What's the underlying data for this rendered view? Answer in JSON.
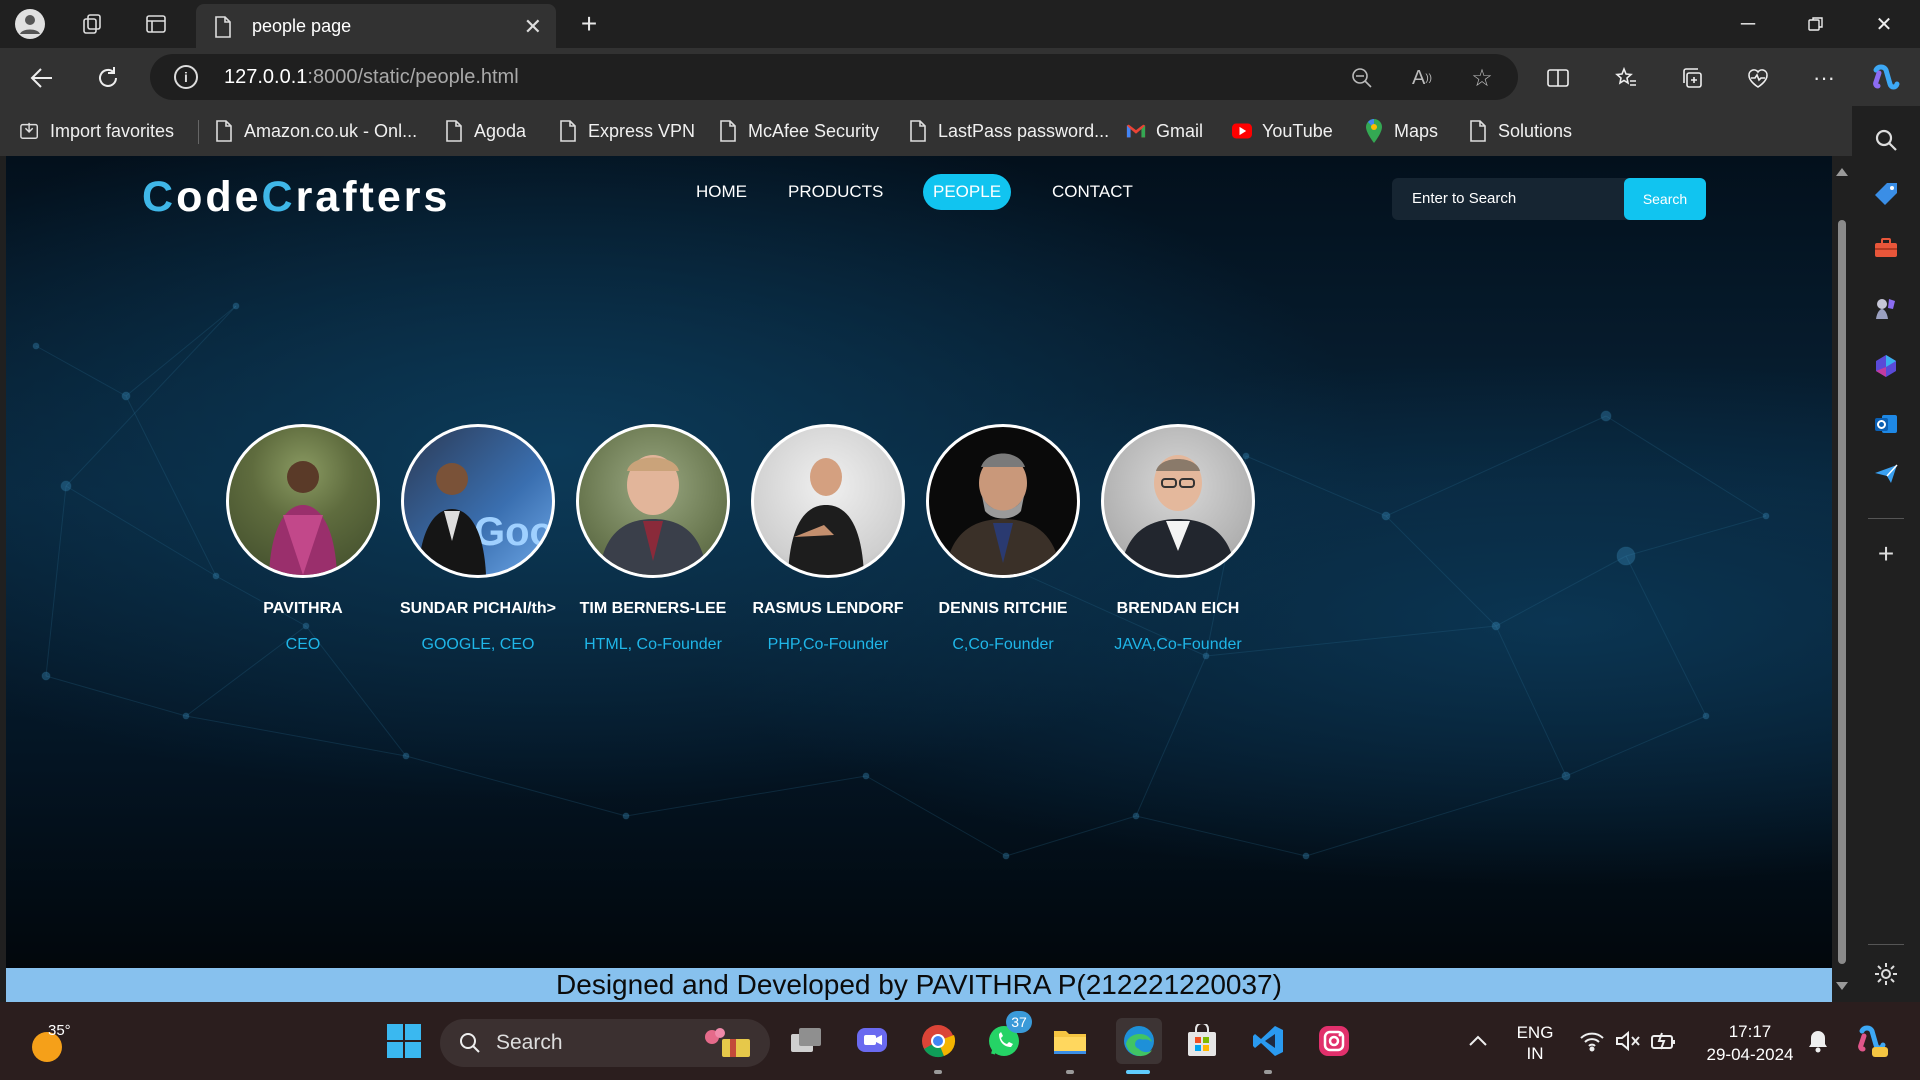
{
  "browser": {
    "tab_title": "people page",
    "url_host": "127.0.0.1",
    "url_rest": ":8000/static/people.html",
    "favorites": [
      {
        "label": "Import favorites",
        "icon": "import-icon"
      },
      {
        "label": "Amazon.co.uk - Onl...",
        "icon": "page-icon"
      },
      {
        "label": "Agoda",
        "icon": "page-icon"
      },
      {
        "label": "Express VPN",
        "icon": "page-icon"
      },
      {
        "label": "McAfee Security",
        "icon": "page-icon"
      },
      {
        "label": "LastPass password...",
        "icon": "page-icon"
      },
      {
        "label": "Gmail",
        "icon": "gmail-icon"
      },
      {
        "label": "YouTube",
        "icon": "youtube-icon"
      },
      {
        "label": "Maps",
        "icon": "maps-icon"
      },
      {
        "label": "Solutions",
        "icon": "page-icon"
      }
    ]
  },
  "site": {
    "logo_c1": "C",
    "logo_rest1": "ode",
    "logo_c2": "C",
    "logo_rest2": "rafters",
    "menu": [
      {
        "label": "HOME",
        "active": false
      },
      {
        "label": "PRODUCTS",
        "active": false
      },
      {
        "label": "PEOPLE",
        "active": true
      },
      {
        "label": "CONTACT",
        "active": false
      }
    ],
    "search_placeholder": "Enter to Search",
    "search_button": "Search",
    "people": [
      {
        "name": "PAVITHRA",
        "role": "CEO"
      },
      {
        "name": "SUNDAR PICHAI/th>",
        "role": "GOOGLE, CEO"
      },
      {
        "name": "TIM BERNERS-LEE",
        "role": "HTML, Co-Founder"
      },
      {
        "name": "RASMUS LENDORF",
        "role": "PHP,Co-Founder"
      },
      {
        "name": "DENNIS RITCHIE",
        "role": "C,Co-Founder"
      },
      {
        "name": "BRENDAN EICH",
        "role": "JAVA,Co-Founder"
      }
    ],
    "footer": "Designed and Developed by PAVITHRA P(212221220037)",
    "accent_color": "#11c4f0"
  },
  "taskbar": {
    "weather_temp": "35°",
    "search_label": "Search",
    "whatsapp_badge": "37",
    "lang_top": "ENG",
    "lang_bottom": "IN",
    "time": "17:17",
    "date": "29-04-2024"
  }
}
